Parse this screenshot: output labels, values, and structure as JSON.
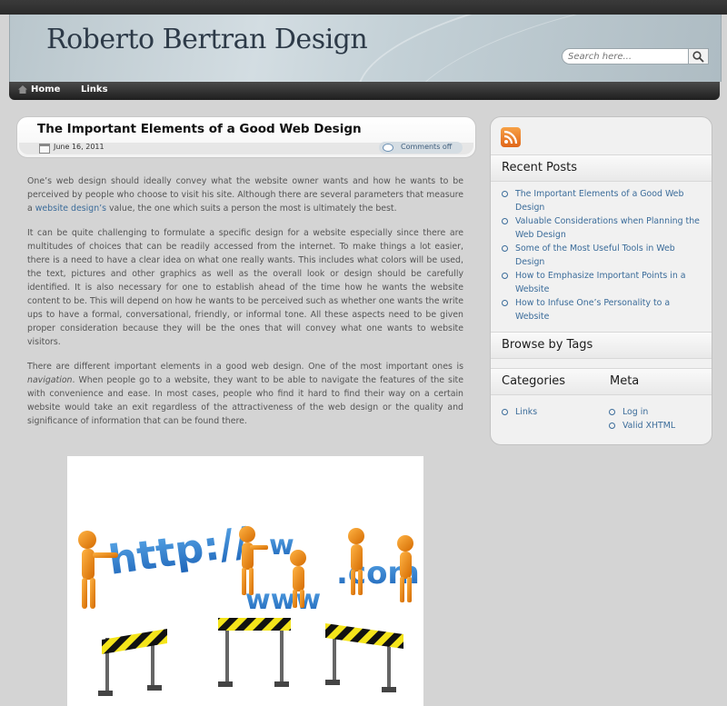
{
  "site": {
    "title": "Roberto Bertran Design",
    "search_placeholder": "Search here..."
  },
  "nav": {
    "items": [
      {
        "label": "Home",
        "icon": "home-icon"
      },
      {
        "label": "Links"
      }
    ]
  },
  "post": {
    "title": "The Important Elements of a Good Web Design",
    "date": "June 16, 2011",
    "comments": "Comments off",
    "p1_a": "One’s web design should ideally convey what the website owner wants and how he wants to be perceived by people who choose to visit his site. Although there are several parameters that measure a ",
    "p1_link": "website design’s",
    "p1_b": " value, the one which suits a person the most is ultimately the best.",
    "p2": "It can be quite challenging to formulate a specific design for a website especially since there are multitudes of choices that can be readily accessed from the internet. To make things a lot easier, there is a need to have a clear idea on what one really wants. This includes what colors will be used, the text, pictures and other graphics as well as the overall look or design should be carefully identified. It is also necessary for one to establish ahead of the time how he wants the website content to be. This will depend on how he wants to be perceived such as whether one wants the write ups to have a formal, conversational, friendly, or informal tone. All these aspects need to be given proper consideration because they will be the ones that will convey what one wants to website visitors.",
    "p3_a": "There are different important elements in a good web design. One of the most important ones is ",
    "p3_em": "navigation",
    "p3_b": ". When people go to a website, they want to be able to navigate the features of the site with convenience and ease. In most cases, people who find it hard to find their way on a certain website would take an exit regardless of the attractiveness of the web design or the quality and significance of information that can be found there.",
    "image": {
      "words": [
        "http://",
        "www",
        "w",
        ".com"
      ]
    }
  },
  "sidebar": {
    "recent_title": "Recent Posts",
    "recent_posts": [
      "The Important Elements of a Good Web Design",
      "Valuable Considerations when Planning the Web Design",
      "Some of the Most Useful Tools in Web Design",
      "How to Emphasize Important Points in a Website",
      "How to Infuse One’s Personality to a Website"
    ],
    "tags_title": "Browse by Tags",
    "categories_title": "Categories",
    "categories": [
      "Links"
    ],
    "meta_title": "Meta",
    "meta": [
      "Log in",
      "Valid XHTML"
    ]
  },
  "colors": {
    "link": "#3b6c9a",
    "title_text": "#2d3a48",
    "rss": "#e0661a"
  }
}
